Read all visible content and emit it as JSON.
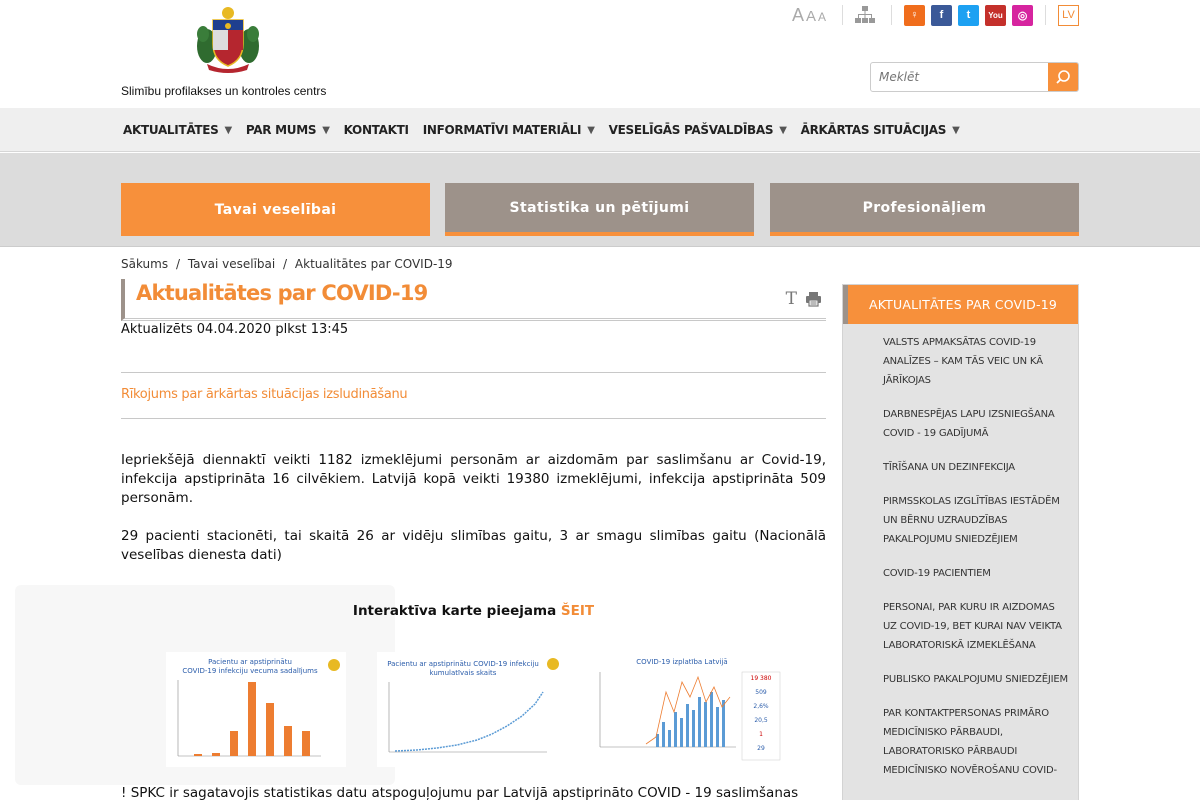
{
  "header": {
    "org_name": "Slimību profilakses un kontroles centrs",
    "font_sizes": [
      "A",
      "A",
      "A"
    ],
    "social": [
      {
        "name": "draugiem",
        "color": "#f06d1c",
        "glyph": "♀"
      },
      {
        "name": "facebook",
        "color": "#3b5998",
        "glyph": "f"
      },
      {
        "name": "twitter",
        "color": "#1da1f2",
        "glyph": "t"
      },
      {
        "name": "youtube",
        "color": "#c4302b",
        "glyph": "You"
      },
      {
        "name": "instagram",
        "color": "#d6249f",
        "glyph": "◎"
      }
    ],
    "lang": "LV",
    "search_placeholder": "Meklēt"
  },
  "nav": [
    {
      "label": "AKTUALITĀTES",
      "has_menu": true
    },
    {
      "label": "PAR MUMS",
      "has_menu": true
    },
    {
      "label": "KONTAKTI",
      "has_menu": false
    },
    {
      "label": "INFORMATĪVI MATERIĀLI",
      "has_menu": true
    },
    {
      "label": "VESELĪGĀS PAŠVALDĪBAS",
      "has_menu": true
    },
    {
      "label": "ĀRKĀRTAS SITUĀCIJAS",
      "has_menu": true
    }
  ],
  "tabs": [
    "Tavai veselībai",
    "Statistika un pētījumi",
    "Profesionāļiem"
  ],
  "breadcrumb": [
    "Sākums",
    "/",
    "Tavai veselībai",
    "/",
    "Aktualitātes par COVID-19"
  ],
  "main": {
    "title": "Aktualitātes par COVID-19",
    "updated": "Aktualizēts 04.04.2020 plkst 13:45",
    "notice_link": "Rīkojums par ārkārtas situācijas izsludināšanu",
    "para1": "Iepriekšējā diennaktī veikti 1182 izmeklējumi personām ar aizdomām par saslimšanu ar Covid-19, infekcija apstiprināta 16 cilvēkiem. Latvijā kopā veikti 19380 izmeklējumi, infekcija apstiprināta 509 personām.",
    "para2": "29 pacienti stacionēti, tai skaitā 26 ar vidēju slimības gaitu, 3 ar smagu slimības gaitu (Nacionālā veselības dienesta dati)",
    "map_text": "Interaktīva karte pieejama ",
    "map_link": "ŠEIT",
    "para3": "! SPKC ir sagatavojis statistikas datu atspoguļojumu par Latvijā apstiprināto COVID - 19 saslimšanas",
    "thumb1_title": "Pacientu ar apstiprinātu COVID-19 infekciju vecuma sadalījums",
    "thumb2_title": "Pacientu ar apstiprinātu COVID-19 infekciju kumulatīvais skaits",
    "thumb3_title": "COVID-19 izplatība Latvijā"
  },
  "sidebar": {
    "heading": "AKTUALITĀTES PAR COVID-19",
    "items": [
      "VALSTS APMAKSĀTAS COVID-19 ANALĪZES – KAM TĀS VEIC UN KĀ JĀRĪKOJAS",
      "DARBNESPĒJAS LAPU IZSNIEGŠANA COVID - 19 GADĪJUMĀ",
      "TĪRĪŠANA UN DEZINFEKCIJA",
      "PIRMSSKOLAS IZGLĪTĪBAS IESTĀDĒM UN BĒRNU UZRAUDZĪBAS PAKALPOJUMU SNIEDZĒJIEM",
      "COVID-19 PACIENTIEM",
      "PERSONAI, PAR KURU IR AIZDOMAS UZ COVID-19, BET KURAI NAV VEIKTA LABORATORISKĀ IZMEKLĒŠANA",
      "PUBLISKO PAKALPOJUMU SNIEDZĒJIEM",
      "PAR KONTAKTPERSONAS PRIMĀRO MEDICĪNISKO PĀRBAUDI, LABORATORISKO PĀRBAUDI MEDICĪNISKO NOVĒROŠANU COVID-"
    ]
  },
  "colors": {
    "accent": "#f7903b",
    "gray_tab": "#9d928a"
  }
}
